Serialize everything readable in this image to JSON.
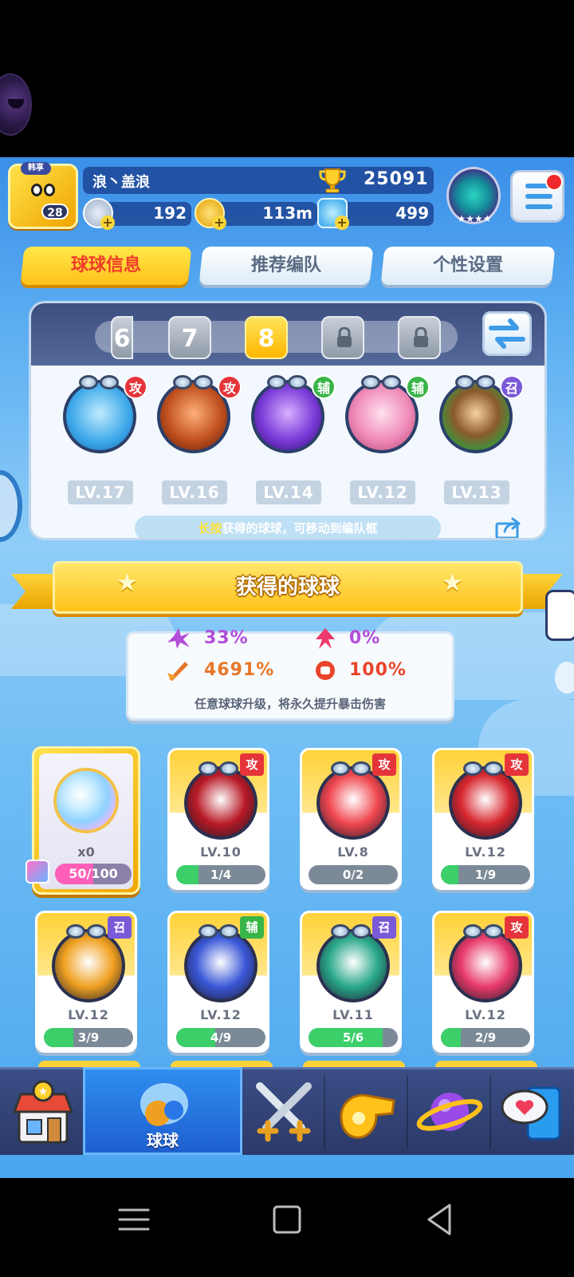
{
  "header": {
    "avatar_badge": "韩享",
    "player_level": "28",
    "player_name": "浪丶盖浪",
    "trophy_icon": "trophy-icon",
    "trophies": "25091",
    "resources": [
      {
        "icon": "energy-icon",
        "value": "192"
      },
      {
        "icon": "gold-coin-icon",
        "value": "113m"
      },
      {
        "icon": "diamond-icon",
        "value": "499"
      }
    ],
    "rank_stars": "★★★★"
  },
  "tabs": [
    {
      "label": "球球信息",
      "active": true
    },
    {
      "label": "推荐编队",
      "active": false
    },
    {
      "label": "个性设置",
      "active": false
    }
  ],
  "team": {
    "slots": [
      {
        "label": "6",
        "state": "partial"
      },
      {
        "label": "7",
        "state": "normal"
      },
      {
        "label": "8",
        "state": "active"
      },
      {
        "label": "",
        "state": "locked"
      },
      {
        "label": "",
        "state": "locked"
      }
    ],
    "balls": [
      {
        "tag": "攻",
        "level": "LV.17",
        "color": "#3aa7e8"
      },
      {
        "tag": "攻",
        "level": "LV.16",
        "color": "#a8401e"
      },
      {
        "tag": "辅",
        "level": "LV.14",
        "color": "#7a3ad8"
      },
      {
        "tag": "辅",
        "level": "LV.12",
        "color": "#f08ab8"
      },
      {
        "tag": "召",
        "level": "LV.13",
        "color": "#5aa04a"
      }
    ],
    "hint_highlight": "长按",
    "hint_text": "获得的球球，可移动到编队框"
  },
  "banner": {
    "title": "获得的球球"
  },
  "stats": {
    "values": [
      "33%",
      "0%",
      "4691%",
      "100%"
    ],
    "description": "任意球球升级，将永久提升暴击伤害"
  },
  "upgrade_card": {
    "count": "x0",
    "progress_text": "50/100",
    "progress": 0.5
  },
  "cards": [
    {
      "tag": "攻",
      "level": "LV.10",
      "progress_text": "1/4",
      "progress": 0.25,
      "color": "#b81a26"
    },
    {
      "tag": "攻",
      "level": "LV.8",
      "progress_text": "0/2",
      "progress": 0.0,
      "color": "#f0464e"
    },
    {
      "tag": "攻",
      "level": "LV.12",
      "progress_text": "1/9",
      "progress": 0.11,
      "color": "#d8262e"
    },
    {
      "tag": "召",
      "level": "LV.12",
      "progress_text": "3/9",
      "progress": 0.33,
      "color": "#f0a020"
    },
    {
      "tag": "辅",
      "level": "LV.12",
      "progress_text": "4/9",
      "progress": 0.44,
      "color": "#3a58d8"
    },
    {
      "tag": "召",
      "level": "LV.11",
      "progress_text": "5/6",
      "progress": 0.83,
      "color": "#2aa88a"
    },
    {
      "tag": "攻",
      "level": "LV.12",
      "progress_text": "2/9",
      "progress": 0.22,
      "color": "#e83a6a"
    }
  ],
  "bottom_nav": [
    {
      "icon": "shop-icon",
      "label": ""
    },
    {
      "icon": "balls-icon",
      "label": "球球",
      "active": true
    },
    {
      "icon": "crossed-swords-icon",
      "label": ""
    },
    {
      "icon": "whistle-icon",
      "label": ""
    },
    {
      "icon": "planet-icon",
      "label": ""
    },
    {
      "icon": "chat-heart-icon",
      "label": ""
    }
  ],
  "system_nav": [
    "menu-icon",
    "home-icon",
    "back-icon"
  ]
}
